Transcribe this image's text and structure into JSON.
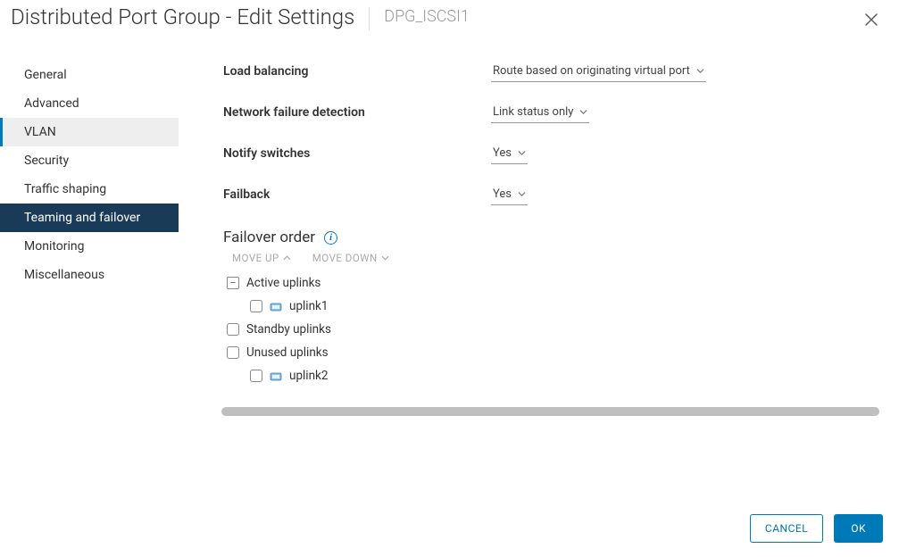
{
  "header": {
    "title": "Distributed Port Group - Edit Settings",
    "subtitle": "DPG_ISCSI1"
  },
  "sidebar": {
    "items": [
      {
        "label": "General"
      },
      {
        "label": "Advanced"
      },
      {
        "label": "VLAN"
      },
      {
        "label": "Security"
      },
      {
        "label": "Traffic shaping"
      },
      {
        "label": "Teaming and failover"
      },
      {
        "label": "Monitoring"
      },
      {
        "label": "Miscellaneous"
      }
    ],
    "active_index": 5,
    "highlight_index": 2
  },
  "settings": {
    "load_balancing": {
      "label": "Load balancing",
      "value": "Route based on originating virtual port"
    },
    "network_failure_detection": {
      "label": "Network failure detection",
      "value": "Link status only"
    },
    "notify_switches": {
      "label": "Notify switches",
      "value": "Yes"
    },
    "failback": {
      "label": "Failback",
      "value": "Yes"
    }
  },
  "failover": {
    "title": "Failover order",
    "move_up": "MOVE UP",
    "move_down": "MOVE DOWN",
    "groups": {
      "active": {
        "label": "Active uplinks",
        "expanded": true,
        "items": [
          "uplink1"
        ]
      },
      "standby": {
        "label": "Standby uplinks",
        "expanded": false,
        "items": []
      },
      "unused": {
        "label": "Unused uplinks",
        "expanded": true,
        "items": [
          "uplink2"
        ]
      }
    }
  },
  "footer": {
    "cancel": "CANCEL",
    "ok": "OK"
  }
}
